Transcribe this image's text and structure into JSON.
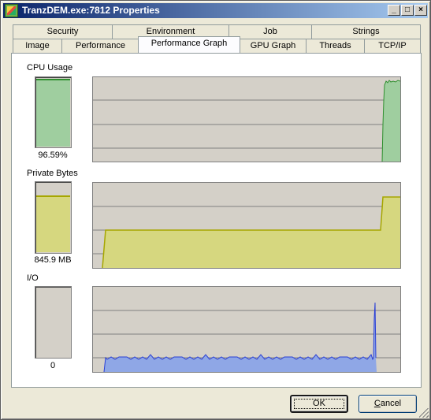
{
  "window": {
    "title": "TranzDEM.exe:7812 Properties",
    "controls": {
      "minimize": "_",
      "maximize": "□",
      "close": "×"
    }
  },
  "tabs": {
    "row_back": [
      "Security",
      "Environment",
      "Job",
      "Strings"
    ],
    "row_front": [
      "Image",
      "Performance",
      "Performance Graph",
      "GPU Graph",
      "Threads",
      "TCP/IP"
    ],
    "active": "Performance Graph"
  },
  "sections": {
    "cpu": {
      "label": "CPU Usage",
      "value": "96.59%",
      "percent": 96.59,
      "color": "#9fce9f",
      "line_color": "#2f8f2f"
    },
    "private": {
      "label": "Private Bytes",
      "value": "845.9 MB",
      "fill_fraction": 0.8,
      "color": "#d6d77f",
      "line_color": "#a6a600"
    },
    "io": {
      "label": "I/O",
      "value": "0",
      "color": "#8fa7e6",
      "line_color": "#2a3fd6"
    }
  },
  "buttons": {
    "ok": "OK",
    "cancel_prefix": "C",
    "cancel_rest": "ancel"
  },
  "colors": {
    "graph_bg": "#d4d0c8",
    "grid": "#808080"
  }
}
